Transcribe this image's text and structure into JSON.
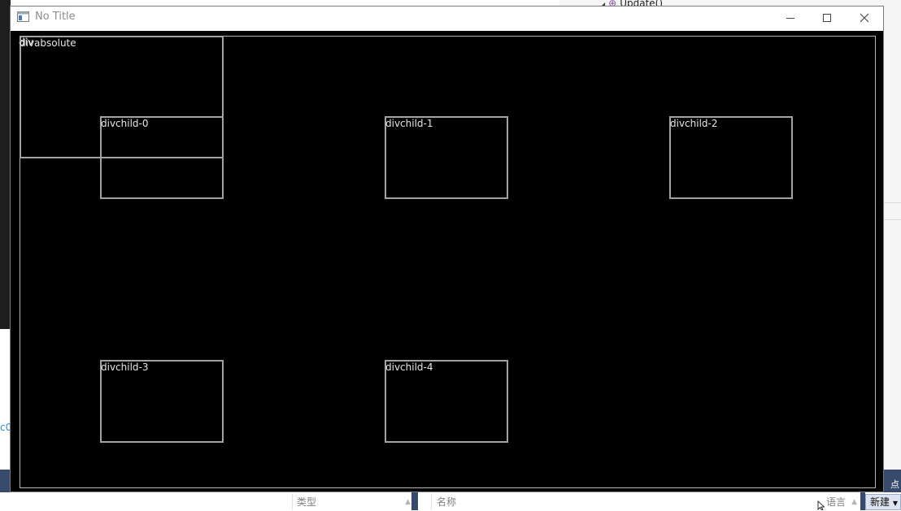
{
  "background": {
    "tree_item": "Update()",
    "left_text": "c0",
    "footer_columns": {
      "type": "类型",
      "name": "名称",
      "language": "语言"
    },
    "new_button": "新建",
    "corner_text": "点"
  },
  "window": {
    "title": "No Title",
    "controls": {
      "minimize": "minimize",
      "maximize": "maximize",
      "close": "close"
    },
    "root_label": "div",
    "absolute_label": "divabsolute",
    "children": [
      {
        "label": "divchild-0"
      },
      {
        "label": "divchild-1"
      },
      {
        "label": "divchild-2"
      },
      {
        "label": "divchild-3"
      },
      {
        "label": "divchild-4"
      }
    ]
  },
  "colors": {
    "window_background": "#000000",
    "box_border": "#a3a3a3",
    "label_text": "#e6e6e6",
    "status_bar": "#384a6b"
  }
}
